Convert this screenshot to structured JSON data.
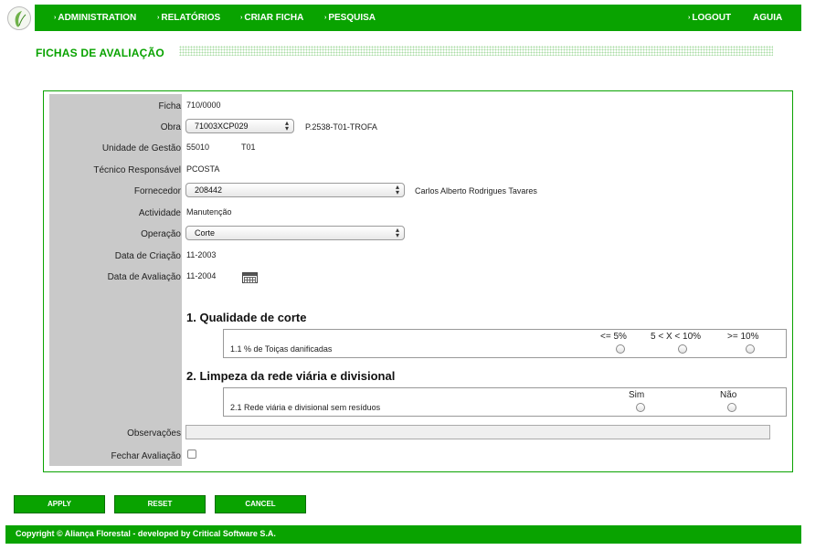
{
  "nav": {
    "items": [
      {
        "label": "ADMINISTRATION"
      },
      {
        "label": "RELATÓRIOS"
      },
      {
        "label": "CRIAR FICHA"
      },
      {
        "label": "PESQUISA"
      }
    ],
    "logout": "LOGOUT",
    "user": "AGUIA",
    "arrow": "›"
  },
  "page_title": "FICHAS DE AVALIAÇÃO",
  "form": {
    "ficha": {
      "label": "Ficha",
      "value": "710/0000"
    },
    "obra": {
      "label": "Obra",
      "selected": "71003XCP029",
      "desc": "P.2538-T01-TROFA"
    },
    "unidade": {
      "label": "Unidade de Gestão",
      "value1": "55010",
      "value2": "T01"
    },
    "tecnico": {
      "label": "Técnico Responsável",
      "value": "PCOSTA"
    },
    "fornecedor": {
      "label": "Fornecedor",
      "selected": "208442",
      "desc": "Carlos Alberto Rodrigues Tavares"
    },
    "actividade": {
      "label": "Actividade",
      "value": "Manutenção"
    },
    "operacao": {
      "label": "Operação",
      "selected": "Corte"
    },
    "data_criacao": {
      "label": "Data de Criação",
      "value": "11-2003"
    },
    "data_avaliacao": {
      "label": "Data de Avaliação",
      "value": "11-2004"
    },
    "observacoes": {
      "label": "Observações",
      "value": ""
    },
    "fechar": {
      "label": "Fechar Avaliação",
      "checked": false
    }
  },
  "sections": [
    {
      "title": "1. Qualidade de corte",
      "question": "1.1 % de Toiças danificadas",
      "options": [
        "<= 5%",
        "5 < X < 10%",
        ">= 10%"
      ]
    },
    {
      "title": "2. Limpeza da rede viária e divisional",
      "question": "2.1 Rede viária e divisional sem resíduos",
      "options": [
        "Sim",
        "Não"
      ]
    }
  ],
  "buttons": {
    "apply": "APPLY",
    "reset": "RESET",
    "cancel": "CANCEL"
  },
  "footer": "Copyright © Aliança Florestal - developed by Critical Software S.A.",
  "colors": {
    "brand_green": "#09a300",
    "label_bg": "#c9c9c9"
  },
  "icons": {
    "select_caret": "⬍",
    "calendar": "calendar-icon"
  }
}
